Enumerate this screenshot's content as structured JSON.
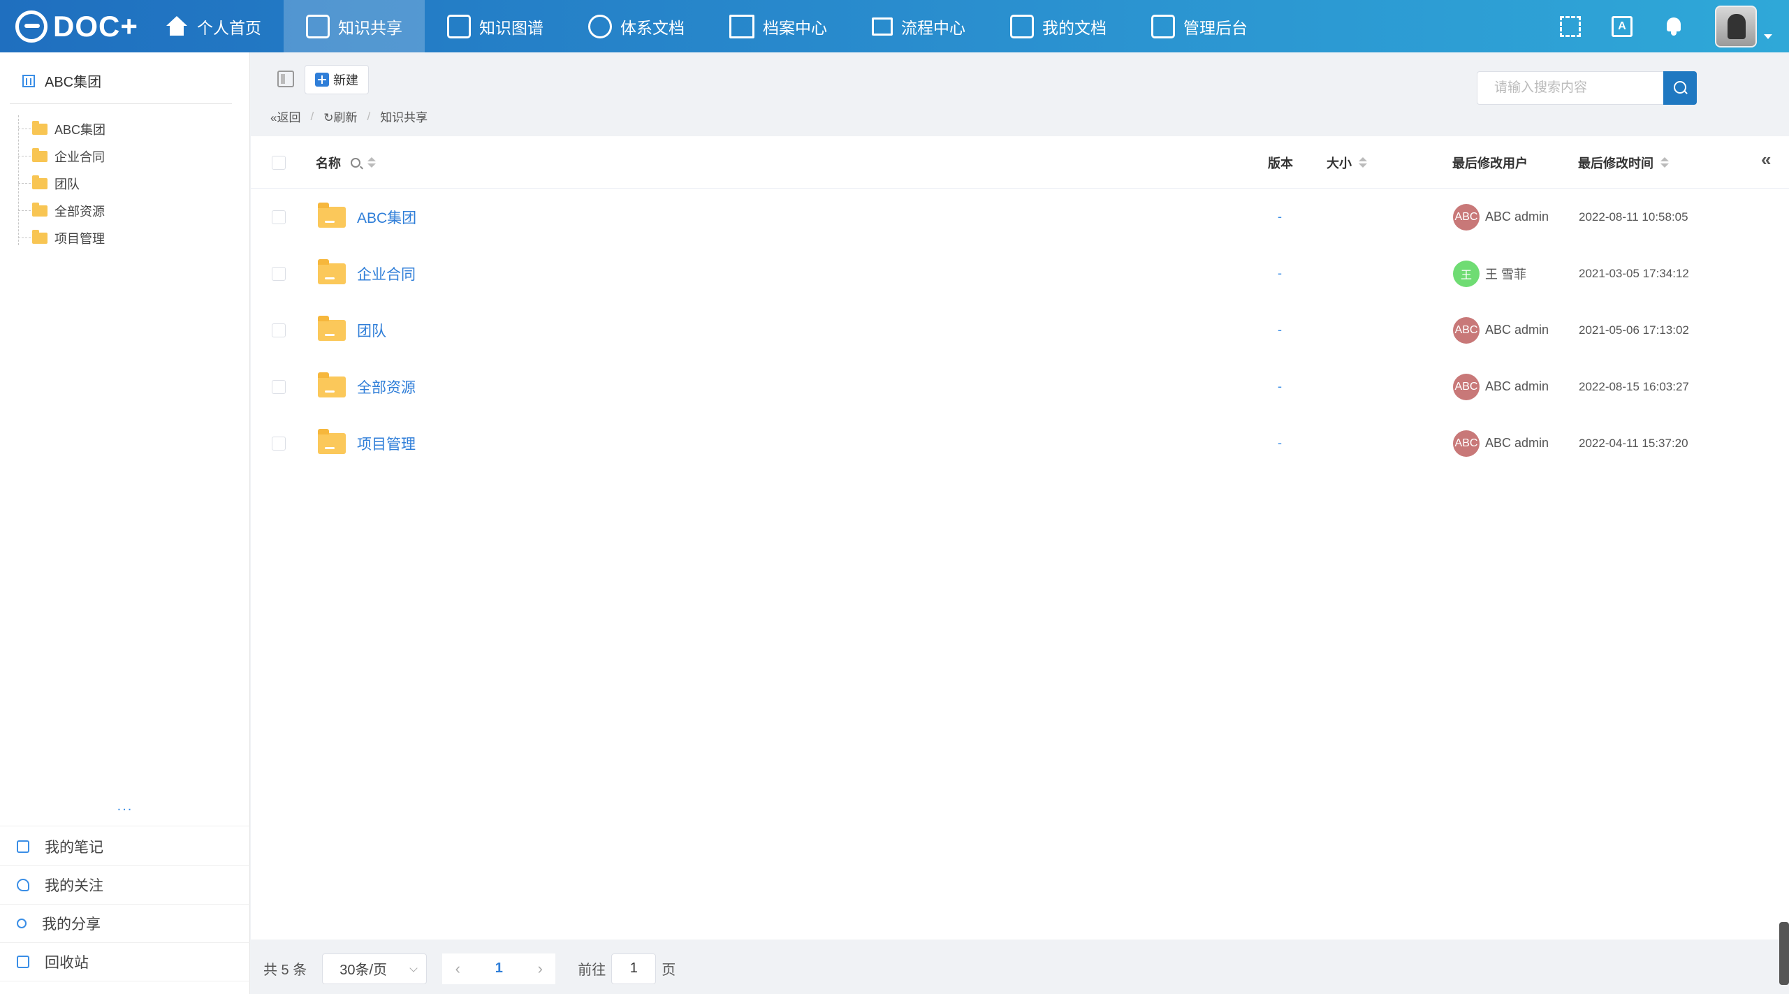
{
  "brand": {
    "logo_text": "DOC+"
  },
  "nav": [
    {
      "label": "个人首页",
      "icon": "home-icon",
      "active": false
    },
    {
      "label": "知识共享",
      "icon": "share-icon",
      "active": true
    },
    {
      "label": "知识图谱",
      "icon": "graph-icon",
      "active": false
    },
    {
      "label": "体系文档",
      "icon": "layers-icon",
      "active": false
    },
    {
      "label": "档案中心",
      "icon": "archive-icon",
      "active": false
    },
    {
      "label": "流程中心",
      "icon": "flow-icon",
      "active": false
    },
    {
      "label": "我的文档",
      "icon": "my-docs-icon",
      "active": false
    },
    {
      "label": "管理后台",
      "icon": "admin-icon",
      "active": false
    }
  ],
  "top_right": {
    "translate_glyph": "A"
  },
  "sidebar": {
    "root": "ABC集团",
    "tree": [
      "ABC集团",
      "企业合同",
      "团队",
      "全部资源",
      "项目管理"
    ],
    "more": "...",
    "links": [
      "我的笔记",
      "我的关注",
      "我的分享",
      "回收站"
    ]
  },
  "toolbar": {
    "new_label": "新建",
    "back": "«返回",
    "sep": "/",
    "refresh": "↻刷新",
    "current": "知识共享",
    "search_placeholder": "请输入搜索内容"
  },
  "table": {
    "headers": {
      "name": "名称",
      "version": "版本",
      "size": "大小",
      "user": "最后修改用户",
      "time": "最后修改时间"
    },
    "collapse_glyph": "«",
    "rows": [
      {
        "name": "ABC集团",
        "version": "-",
        "size": "",
        "avatar": "ABC",
        "avatar_color": "#c87878",
        "user": "ABC admin",
        "time": "2022-08-11 10:58:05"
      },
      {
        "name": "企业合同",
        "version": "-",
        "size": "",
        "avatar": "王",
        "avatar_color": "#6fdc73",
        "user": "王 雪菲",
        "time": "2021-03-05 17:34:12"
      },
      {
        "name": "团队",
        "version": "-",
        "size": "",
        "avatar": "ABC",
        "avatar_color": "#c87878",
        "user": "ABC admin",
        "time": "2021-05-06 17:13:02"
      },
      {
        "name": "全部资源",
        "version": "-",
        "size": "",
        "avatar": "ABC",
        "avatar_color": "#c87878",
        "user": "ABC admin",
        "time": "2022-08-15 16:03:27"
      },
      {
        "name": "项目管理",
        "version": "-",
        "size": "",
        "avatar": "ABC",
        "avatar_color": "#c87878",
        "user": "ABC admin",
        "time": "2022-04-11 15:37:20"
      }
    ]
  },
  "pager": {
    "total": "共 5 条",
    "page_size": "30条/页",
    "prev": "‹",
    "current_page": "1",
    "next": "›",
    "goto_label": "前往",
    "goto_value": "1",
    "page_suffix": "页"
  }
}
